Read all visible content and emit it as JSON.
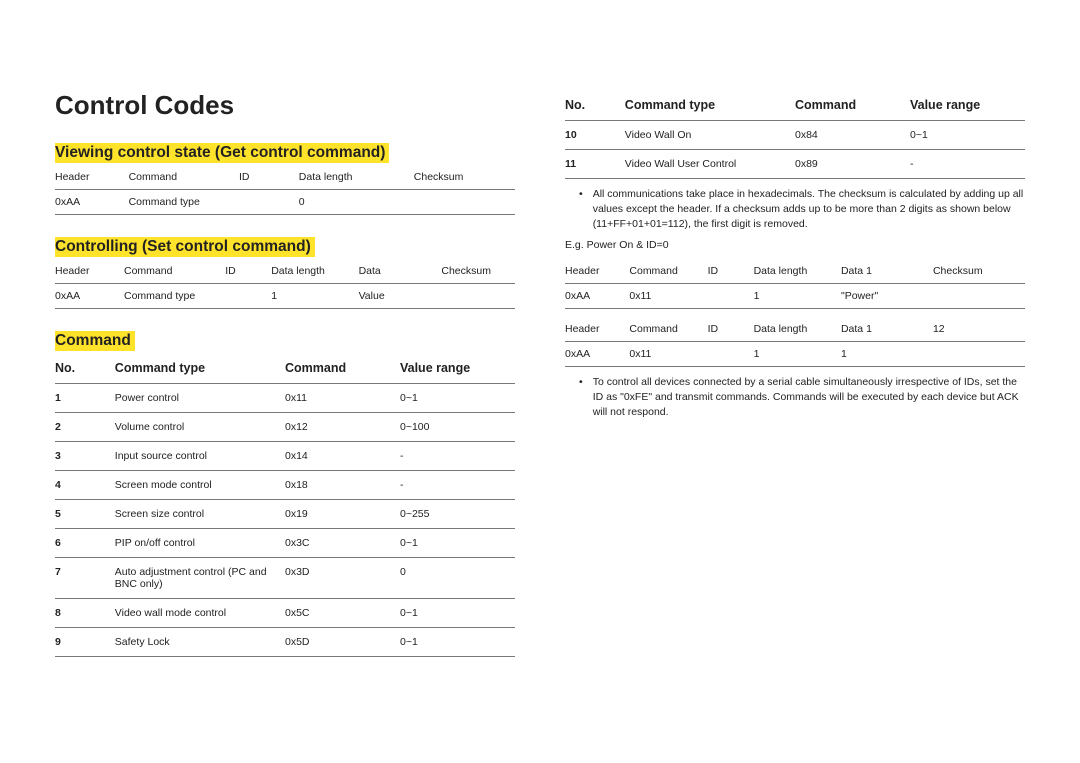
{
  "title": "Control Codes",
  "section_view": "Viewing control state (Get control command)",
  "section_set": "Controlling (Set control command)",
  "section_cmd": "Command",
  "view_head": [
    "Header",
    "Command",
    "ID",
    "Data length",
    "Checksum"
  ],
  "view_row": [
    "0xAA",
    "Command type",
    "",
    "0",
    ""
  ],
  "set_head": [
    "Header",
    "Command",
    "ID",
    "Data length",
    "Data",
    "Checksum"
  ],
  "set_row": [
    "0xAA",
    "Command type",
    "",
    "1",
    "Value",
    ""
  ],
  "cmd_head": [
    "No.",
    "Command type",
    "Command",
    "Value range"
  ],
  "cmds_left": [
    [
      "1",
      "Power control",
      "0x11",
      "0~1"
    ],
    [
      "2",
      "Volume control",
      "0x12",
      "0~100"
    ],
    [
      "3",
      "Input source control",
      "0x14",
      "-"
    ],
    [
      "4",
      "Screen mode control",
      "0x18",
      "-"
    ],
    [
      "5",
      "Screen size control",
      "0x19",
      "0~255"
    ],
    [
      "6",
      "PIP on/off control",
      "0x3C",
      "0~1"
    ],
    [
      "7",
      "Auto adjustment control (PC and BNC only)",
      "0x3D",
      "0"
    ],
    [
      "8",
      "Video wall mode control",
      "0x5C",
      "0~1"
    ],
    [
      "9",
      "Safety Lock",
      "0x5D",
      "0~1"
    ]
  ],
  "cmds_right": [
    [
      "10",
      "Video Wall On",
      "0x84",
      "0~1"
    ],
    [
      "11",
      "Video Wall User Control",
      "0x89",
      "-"
    ]
  ],
  "bullet1": "All communications take place in hexadecimals. The checksum is calculated by adding up all values except the header. If a checksum adds up to be more than 2 digits as shown below (11+FF+01+01=112), the first digit is removed.",
  "note_ex": "E.g. Power On & ID=0",
  "ex_head": [
    "Header",
    "Command",
    "ID",
    "Data length",
    "Data 1",
    "Checksum"
  ],
  "ex_row1": [
    "0xAA",
    "0x11",
    "",
    "1",
    "\"Power\"",
    ""
  ],
  "ex2_head": [
    "Header",
    "Command",
    "ID",
    "Data length",
    "Data 1",
    "12"
  ],
  "ex2_row": [
    "0xAA",
    "0x11",
    "",
    "1",
    "1",
    ""
  ],
  "bullet2": "To control all devices connected by a serial cable simultaneously irrespective of IDs, set the ID as \"0xFE\" and transmit commands. Commands will be executed by each device but ACK will not respond."
}
